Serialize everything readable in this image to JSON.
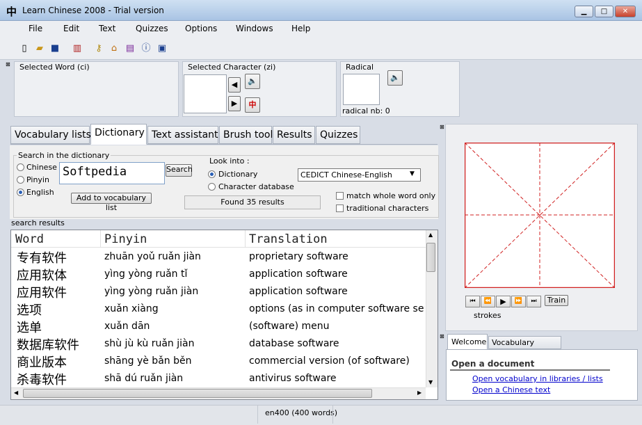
{
  "window": {
    "title": "Learn Chinese 2008 - Trial version",
    "app_glyph": "中",
    "min": "▁",
    "max": "□",
    "close": "✕"
  },
  "menu": [
    "File",
    "Edit",
    "Text",
    "Quizzes",
    "Options",
    "Windows",
    "Help"
  ],
  "toolbar_icons": [
    "new-file-icon",
    "open-folder-icon",
    "save-icon",
    "library-icon",
    "key-icon",
    "home-icon",
    "book-icon",
    "info-icon",
    "monitor-icon"
  ],
  "top_panels": {
    "selected_word_label": "Selected Word (ci)",
    "selected_char_label": "Selected Character (zi)",
    "radical_label": "Radical",
    "radical_nb": "radical nb: 0",
    "char_button_glyph": "中"
  },
  "tabs": [
    "Vocabulary lists",
    "Dictionary",
    "Text assistant",
    "Brush tool",
    "Results",
    "Quizzes"
  ],
  "active_tab": "Dictionary",
  "search": {
    "group_label": "Search in the dictionary",
    "options": [
      "Chinese",
      "Pinyin",
      "English"
    ],
    "selected": "English",
    "query": "Softpedia",
    "search_button": "Search",
    "add_button": "Add to vocabulary list"
  },
  "look_into": {
    "label": "Look into :",
    "options": [
      "Dictionary",
      "Character database"
    ],
    "selected": "Dictionary",
    "dictionary_select": "CEDICT Chinese-English",
    "found": "Found 35 results",
    "match_whole_word": "match whole word only",
    "traditional": "traditional characters"
  },
  "results": {
    "label": "search results",
    "headers": [
      "Word",
      "Pinyin",
      "Translation"
    ],
    "rows": [
      {
        "word": "专有软件",
        "pinyin": "zhuān yoǔ ruǎn jiàn",
        "translation": "proprietary software"
      },
      {
        "word": "应用软体",
        "pinyin": "yìng yòng ruǎn tǐ",
        "translation": "application software"
      },
      {
        "word": "应用软件",
        "pinyin": "yìng yòng ruǎn jiàn",
        "translation": "application software"
      },
      {
        "word": "选项",
        "pinyin": "xuǎn xiàng",
        "translation": "options (as in computer software settin"
      },
      {
        "word": "选单",
        "pinyin": "xuǎn dān",
        "translation": "(software) menu"
      },
      {
        "word": "数据库软件",
        "pinyin": "shù jù kù ruǎn jiàn",
        "translation": "database software"
      },
      {
        "word": "商业版本",
        "pinyin": "shāng yè bǎn běn",
        "translation": "commercial version (of software)"
      },
      {
        "word": "杀毒软件",
        "pinyin": "shā dú ruǎn jiàn",
        "translation": "antivirus software"
      }
    ]
  },
  "stroke_panel": {
    "train_button": "Train",
    "strokes_label": "strokes"
  },
  "welcome": {
    "tabs": [
      "Welcome",
      "Vocabulary manager"
    ],
    "heading": "Open a document",
    "links": [
      "Open vocabulary in libraries / lists",
      "Open a Chinese text"
    ]
  },
  "status": "en400 (400 words)"
}
